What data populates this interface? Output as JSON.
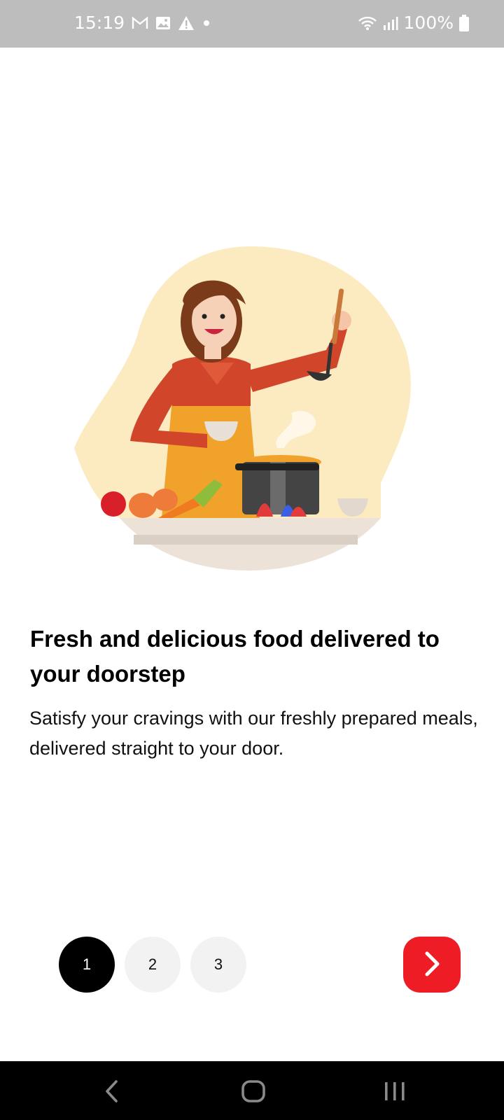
{
  "status_bar": {
    "time": "15:19",
    "notification_icons": [
      "gmail-icon",
      "gallery-icon",
      "alert-icon",
      "dot-icon"
    ],
    "battery": "100%",
    "system_icons": [
      "wifi-icon",
      "signal-icon",
      "battery-icon"
    ]
  },
  "onboarding": {
    "illustration": "woman-cooking-illustration",
    "title": "Fresh and delicious food delivered to your doorstep",
    "description": "Satisfy your cravings with our freshly prepared meals, delivered straight to your door.",
    "pages": [
      "1",
      "2",
      "3"
    ],
    "active_page": 1,
    "next_icon": "chevron-right-icon"
  },
  "colors": {
    "accent": "#EE1C25",
    "active_dot": "#000000",
    "inactive_dot": "#F2F2F2",
    "blob": "#FCEBC1"
  },
  "nav_bar": {
    "buttons": [
      "back-icon",
      "home-icon",
      "recents-icon"
    ]
  }
}
